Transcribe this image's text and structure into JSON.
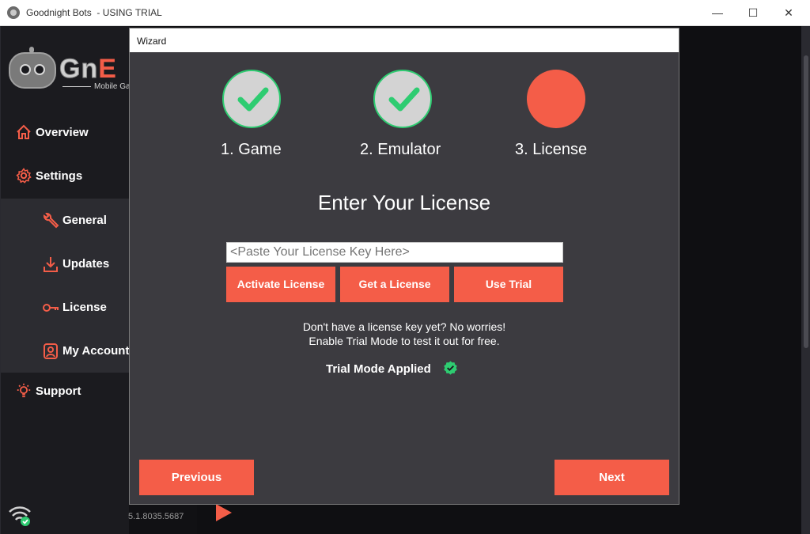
{
  "window": {
    "title": "Goodnight Bots  - USING TRIAL",
    "minimize_glyph": "—",
    "maximize_glyph": "☐",
    "close_glyph": "✕"
  },
  "brand": {
    "logo_text_main": "Gn",
    "logo_text_accent": "E",
    "tagline": "Mobile Ga"
  },
  "sidebar": {
    "overview": "Overview",
    "settings": "Settings",
    "sub_items": [
      "General",
      "Updates",
      "License",
      "My Account"
    ],
    "support": "Support",
    "version": "5.1.8035.5687",
    "accent_color": "#f45d48",
    "icons": [
      "home-icon",
      "gear-icon",
      "wrench-icon",
      "download-icon",
      "key-icon",
      "user-icon",
      "lightbulb-icon",
      "wifi-icon"
    ]
  },
  "wizard": {
    "title": "Wizard",
    "steps": [
      {
        "label": "1. Game",
        "status": "done"
      },
      {
        "label": "2. Emulator",
        "status": "done"
      },
      {
        "label": "3. License",
        "status": "active"
      }
    ],
    "heading": "Enter Your License",
    "license_input": {
      "value": "",
      "placeholder": "<Paste Your License Key Here>"
    },
    "buttons": {
      "activate": "Activate License",
      "get": "Get a License",
      "trial": "Use Trial",
      "previous": "Previous",
      "next": "Next"
    },
    "info_line1": "Don't have a license key yet? No worries!",
    "info_line2": "Enable Trial Mode to test it out for free.",
    "trial_status": "Trial Mode Applied",
    "colors": {
      "accent": "#f45d48",
      "success": "#2ecc71",
      "panel": "#3c3b40"
    }
  }
}
